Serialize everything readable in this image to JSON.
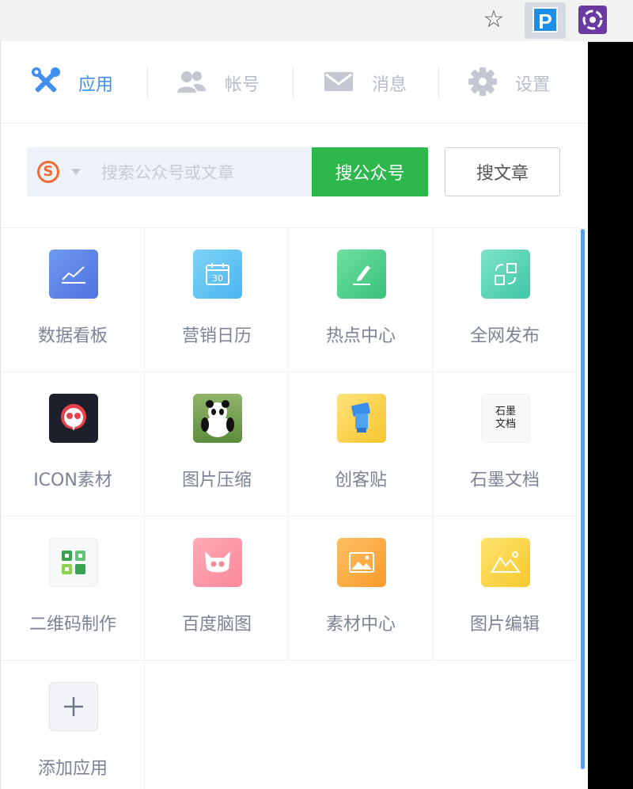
{
  "tabs": [
    {
      "label": "应用",
      "icon": "tools-icon",
      "active": true
    },
    {
      "label": "帐号",
      "icon": "users-icon",
      "active": false
    },
    {
      "label": "消息",
      "icon": "mail-icon",
      "active": false
    },
    {
      "label": "设置",
      "icon": "gear-icon",
      "active": false
    }
  ],
  "search": {
    "engine_icon": "sogou-icon",
    "placeholder": "搜索公众号或文章",
    "value": "",
    "btn_account": "搜公众号",
    "btn_article": "搜文章"
  },
  "apps": [
    {
      "label": "数据看板",
      "icon": "chart-icon"
    },
    {
      "label": "营销日历",
      "icon": "calendar-icon",
      "day": "30"
    },
    {
      "label": "热点中心",
      "icon": "pen-icon"
    },
    {
      "label": "全网发布",
      "icon": "publish-icon"
    },
    {
      "label": "ICON素材",
      "icon": "skull-icon"
    },
    {
      "label": "图片压缩",
      "icon": "panda-icon"
    },
    {
      "label": "创客贴",
      "icon": "chuangketie-icon"
    },
    {
      "label": "石墨文档",
      "icon": "shimo-icon",
      "logo_text": "石墨文档"
    },
    {
      "label": "二维码制作",
      "icon": "qrcode-icon"
    },
    {
      "label": "百度脑图",
      "icon": "mindmap-icon"
    },
    {
      "label": "素材中心",
      "icon": "image-icon"
    },
    {
      "label": "图片编辑",
      "icon": "photo-edit-icon"
    },
    {
      "label": "添加应用",
      "icon": "plus-icon"
    }
  ],
  "colors": {
    "accent": "#3f8ef0",
    "green": "#2cb84c"
  }
}
